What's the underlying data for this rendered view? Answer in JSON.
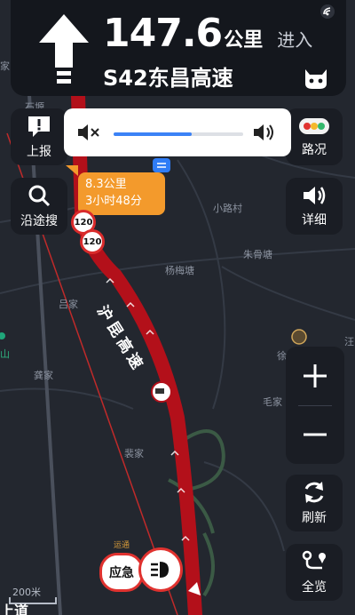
{
  "nav": {
    "distance_value": "147.6",
    "distance_unit": "公里",
    "action": "进入",
    "road_name": "S42东昌高速",
    "maneuver_icon": "straight-arrow-icon",
    "assistant_icon": "cat-face-icon"
  },
  "volume": {
    "level": 0.6
  },
  "eta": {
    "distance": "8.3公里",
    "time": "3小时48分"
  },
  "speed_limits": [
    "120",
    "120"
  ],
  "route_label": "沪昆高速",
  "buttons": {
    "report": "上报",
    "search_along": "沿途搜",
    "traffic": "路况",
    "details": "详细",
    "refresh": "刷新",
    "overview": "全览",
    "emergency": "应急"
  },
  "places": {
    "home": "家",
    "shiyuan": "石塬",
    "xiaoluchun": "小路村",
    "zhugutang": "朱骨塘",
    "yangmeitang": "杨梅塘",
    "lvjia": "吕家",
    "gongjia": "龚家",
    "maojia": "毛家",
    "peijia": "裴家",
    "xu": "徐",
    "wang": "汪",
    "shan": "山",
    "ruyi": "运通"
  },
  "scale": "200米",
  "bottom_road": "上道",
  "colors": {
    "route": "#b3101a",
    "accent": "#3b82f6",
    "eta": "#f39a2c"
  }
}
